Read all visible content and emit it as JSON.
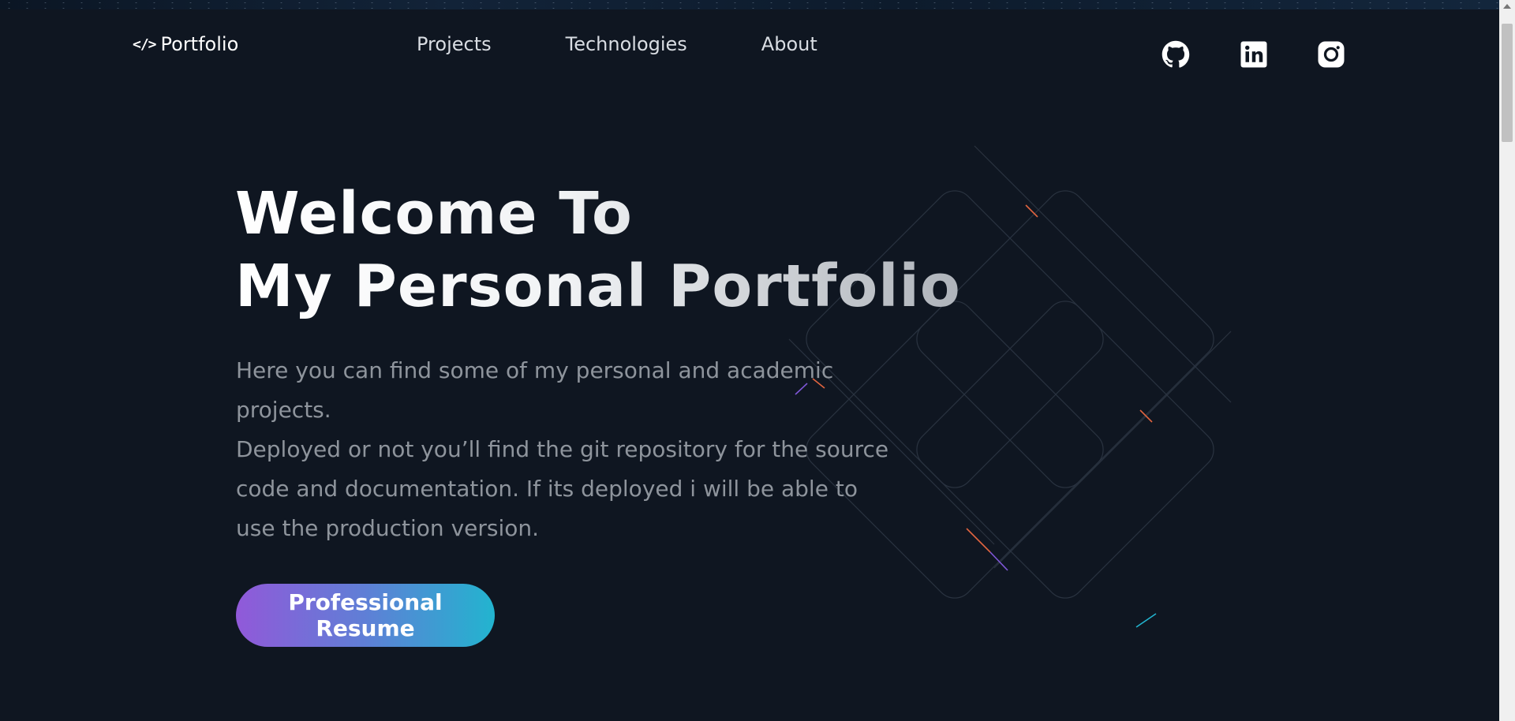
{
  "nav": {
    "logo_text": "Portfolio",
    "logo_code": "</>",
    "links": [
      {
        "label": "Projects"
      },
      {
        "label": "Technologies"
      },
      {
        "label": "About"
      }
    ],
    "social": [
      {
        "icon": "github-icon"
      },
      {
        "icon": "linkedin-icon"
      },
      {
        "icon": "instagram-icon"
      }
    ]
  },
  "hero": {
    "title_line1": "Welcome To",
    "title_line2": "My Personal Portfolio",
    "desc_para1": "Here you can find some of my personal and academic projects.",
    "desc_para2": "Deployed or not you’ll find the git repository for the source code and documentation. If its deployed i will be able to use the production version.",
    "button_label": "Professional Resume"
  },
  "colors": {
    "background": "#0f1621",
    "button_gradient_start": "#9159d9",
    "button_gradient_end": "#22b4cf"
  }
}
